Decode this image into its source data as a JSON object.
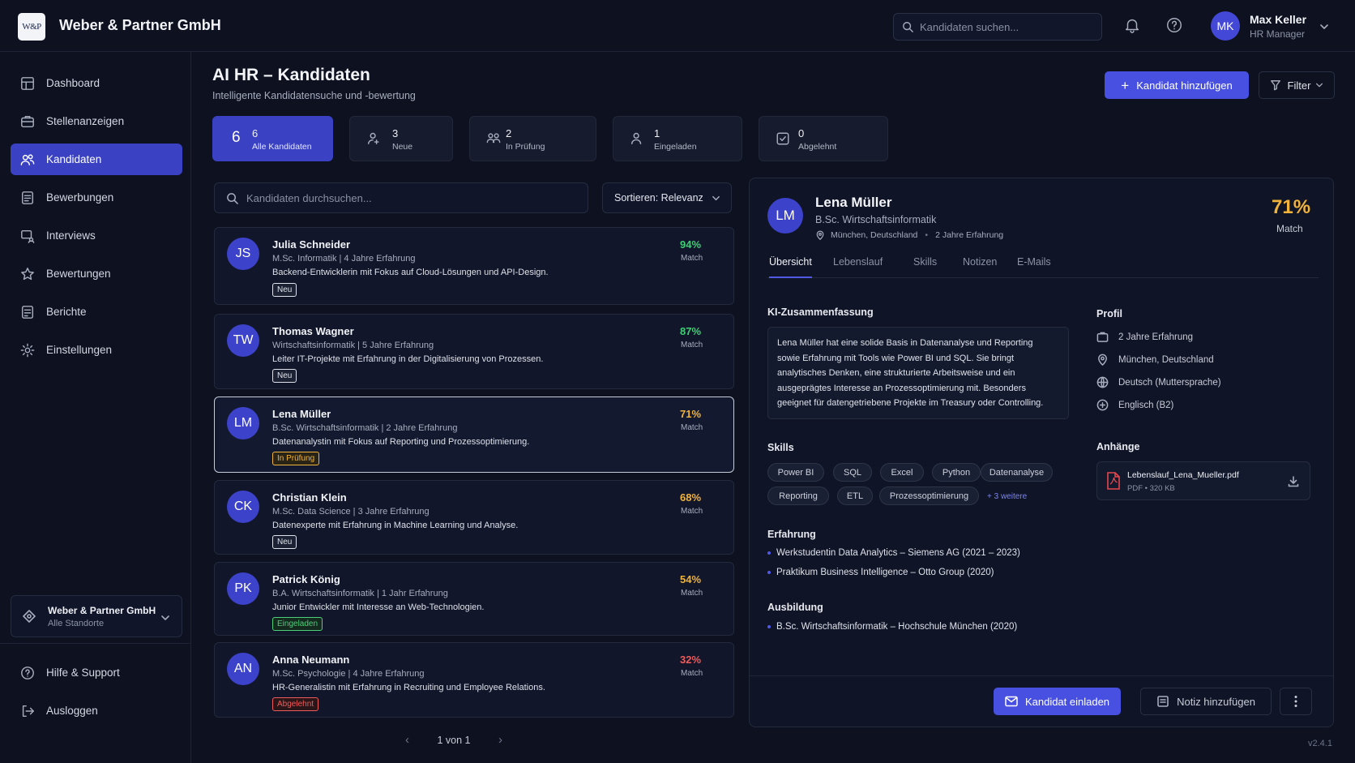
{
  "header": {
    "logo_text": "W&P",
    "company": "Weber & Partner GmbH",
    "search_placeholder": "Kandidaten suchen...",
    "user": {
      "initials": "MK",
      "name": "Max Keller",
      "role": "HR Manager"
    }
  },
  "sidebar": {
    "items": [
      {
        "label": "Dashboard",
        "icon": "dashboard-icon"
      },
      {
        "label": "Stellenanzeigen",
        "icon": "briefcase-icon"
      },
      {
        "label": "Kandidaten",
        "icon": "users-icon",
        "active": true
      },
      {
        "label": "Bewerbungen",
        "icon": "document-icon"
      },
      {
        "label": "Interviews",
        "icon": "interview-icon"
      },
      {
        "label": "Bewertungen",
        "icon": "star-icon"
      },
      {
        "label": "Berichte",
        "icon": "report-icon"
      },
      {
        "label": "Einstellungen",
        "icon": "gear-icon"
      }
    ],
    "org": {
      "name": "Weber & Partner GmbH",
      "sub": "Alle Standorte"
    },
    "bottom": [
      {
        "label": "Hilfe & Support",
        "icon": "help-icon"
      },
      {
        "label": "Ausloggen",
        "icon": "logout-icon"
      }
    ]
  },
  "page": {
    "title": "AI HR – Kandidaten",
    "subtitle": "Intelligente Kandidatensuche und -bewertung",
    "add_button": "Kandidat hinzufügen",
    "filter_button": "Filter"
  },
  "stats": [
    {
      "big": "6",
      "num": "6",
      "label": "Alle Kandidaten",
      "active": true
    },
    {
      "num": "3",
      "label": "Neue",
      "icon": "new-user-icon"
    },
    {
      "num": "2",
      "label": "In Prüfung",
      "icon": "review-icon"
    },
    {
      "num": "1",
      "label": "Eingeladen",
      "icon": "invited-icon"
    },
    {
      "num": "0",
      "label": "Abgelehnt",
      "icon": "rejected-icon"
    }
  ],
  "list": {
    "search_placeholder": "Kandidaten durchsuchen...",
    "sort_label": "Sortieren: Relevanz",
    "match_label": "Match",
    "candidates": [
      {
        "initials": "JS",
        "name": "Julia Schneider",
        "edu": "M.Sc. Informatik | 4 Jahre Erfahrung",
        "desc": "Backend-Entwicklerin mit Fokus auf Cloud-Lösungen und API-Design.",
        "status": "Neu",
        "pct": "94%",
        "color": "#3fcf74"
      },
      {
        "initials": "TW",
        "name": "Thomas Wagner",
        "edu": "Wirtschaftsinformatik | 5 Jahre Erfahrung",
        "desc": "Leiter IT-Projekte mit Erfahrung in der Digitalisierung von Prozessen.",
        "status": "Neu",
        "pct": "87%",
        "color": "#3fcf74"
      },
      {
        "initials": "LM",
        "name": "Lena Müller",
        "edu": "B.Sc. Wirtschaftsinformatik | 2 Jahre Erfahrung",
        "desc": "Datenanalystin mit Fokus auf Reporting und Prozessoptimierung.",
        "status": "In Prüfung",
        "pct": "71%",
        "color": "#f0b33c"
      },
      {
        "initials": "CK",
        "name": "Christian Klein",
        "edu": "M.Sc. Data Science | 3 Jahre Erfahrung",
        "desc": "Datenexperte mit Erfahrung in Machine Learning und Analyse.",
        "status": "Neu",
        "pct": "68%",
        "color": "#f0b33c"
      },
      {
        "initials": "PK",
        "name": "Patrick König",
        "edu": "B.A. Wirtschaftsinformatik | 1 Jahr Erfahrung",
        "desc": "Junior Entwickler mit Interesse an Web-Technologien.",
        "status": "Eingeladen",
        "pct": "54%",
        "color": "#f0b33c"
      },
      {
        "initials": "AN",
        "name": "Anna Neumann",
        "edu": "M.Sc. Psychologie | 4 Jahre Erfahrung",
        "desc": "HR-Generalistin mit Erfahrung in Recruiting und Employee Relations.",
        "status": "Abgelehnt",
        "pct": "32%",
        "color": "#ef5b5b"
      }
    ],
    "pager": "1 von 1"
  },
  "detail": {
    "initials": "LM",
    "name": "Lena Müller",
    "edu": "B.Sc. Wirtschaftsinformatik",
    "location": "München, Deutschland",
    "experience": "2 Jahre Erfahrung",
    "pct": "71%",
    "match": "Match",
    "tabs": [
      "Übersicht",
      "Lebenslauf",
      "Skills",
      "Notizen",
      "E-Mails"
    ],
    "summary_title": "KI-Zusammenfassung",
    "summary_lines": [
      "Lena Müller hat eine solide Basis in Datenanalyse und Reporting",
      "sowie Erfahrung mit Tools wie Power BI und SQL. Sie bringt",
      "analytisches Denken, eine strukturierte Arbeitsweise und ein",
      "ausgeprägtes Interesse an Prozessoptimierung mit. Besonders",
      "geeignet für datengetriebene Projekte im Treasury oder Controlling."
    ],
    "skills_title": "Skills",
    "skills": [
      "Power BI",
      "SQL",
      "Excel",
      "Python",
      "Datenanalyse",
      "Reporting",
      "ETL",
      "Prozessoptimierung"
    ],
    "more_skills": "+ 3 weitere",
    "experience_title": "Erfahrung",
    "experience_items": [
      "Werkstudentin Data Analytics – Siemens AG (2021 – 2023)",
      "Praktikum Business Intelligence – Otto Group (2020)"
    ],
    "education_title": "Ausbildung",
    "education_items": [
      "B.Sc. Wirtschaftsinformatik – Hochschule München (2020)"
    ],
    "profile_title": "Profil",
    "profile": [
      "2 Jahre Erfahrung",
      "München, Deutschland",
      "Deutsch (Muttersprache)",
      "Englisch (B2)"
    ],
    "attachments_title": "Anhänge",
    "attachment": {
      "name": "Lebenslauf_Lena_Mueller.pdf",
      "size": "PDF • 320 KB"
    },
    "invite_button": "Kandidat einladen",
    "note_button": "Notiz hinzufügen"
  },
  "version": "v2.4.1"
}
